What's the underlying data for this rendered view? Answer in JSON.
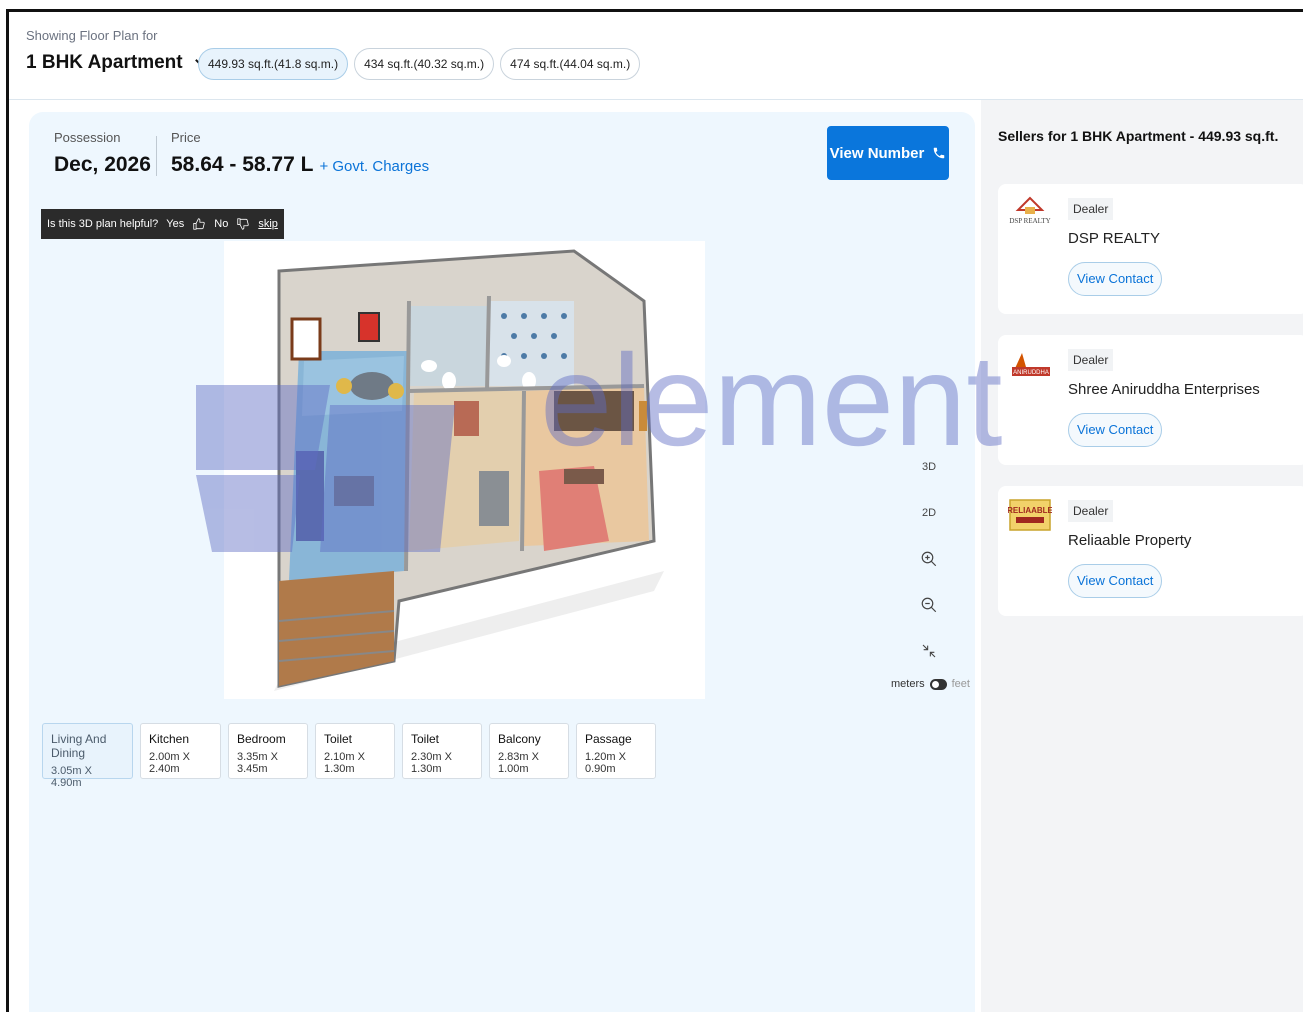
{
  "header": {
    "showing_label": "Showing Floor Plan for",
    "config_label": "1 BHK Apartment",
    "sizes": [
      {
        "label": "449.93 sq.ft.(41.8 sq.m.)",
        "active": true
      },
      {
        "label": "434 sq.ft.(40.32 sq.m.)",
        "active": false
      },
      {
        "label": "474 sq.ft.(44.04 sq.m.)",
        "active": false
      }
    ]
  },
  "summary": {
    "possession_label": "Possession",
    "possession_value": "Dec, 2026",
    "price_label": "Price",
    "price_value": "58.64 - 58.77 L",
    "price_extra": "+ Govt. Charges",
    "view_number_label": "View Number"
  },
  "feedback": {
    "question": "Is this 3D plan helpful?",
    "yes": "Yes",
    "no": "No",
    "skip": "skip"
  },
  "viewer": {
    "view_3d": "3D",
    "view_2d": "2D",
    "unit_meters": "meters",
    "unit_feet": "feet"
  },
  "rooms": [
    {
      "name": "Living And Dining",
      "dims": "3.05m X 4.90m",
      "active": true
    },
    {
      "name": "Kitchen",
      "dims": "2.00m X 2.40m",
      "active": false
    },
    {
      "name": "Bedroom",
      "dims": "3.35m X 3.45m",
      "active": false
    },
    {
      "name": "Toilet",
      "dims": "2.10m X 1.30m",
      "active": false
    },
    {
      "name": "Toilet",
      "dims": "2.30m X 1.30m",
      "active": false
    },
    {
      "name": "Balcony",
      "dims": "2.83m X 1.00m",
      "active": false
    },
    {
      "name": "Passage",
      "dims": "1.20m X 0.90m",
      "active": false
    }
  ],
  "sellers": {
    "title": "Sellers for 1 BHK Apartment - 449.93 sq.ft.",
    "items": [
      {
        "tag": "Dealer",
        "name": "DSP REALTY",
        "action": "View Contact",
        "logo_text": "DSP REALTY"
      },
      {
        "tag": "Dealer",
        "name": "Shree Aniruddha Enterprises",
        "action": "View Contact",
        "logo_text": "ANIRUDDHA"
      },
      {
        "tag": "Dealer",
        "name": "Reliaable Property",
        "action": "View Contact",
        "logo_text": "RELIAABLE"
      }
    ]
  },
  "watermark": {
    "text": "element"
  },
  "colors": {
    "accent": "#0a76dc",
    "panel": "#eef7fe",
    "sidebar": "#f3f4f6"
  }
}
